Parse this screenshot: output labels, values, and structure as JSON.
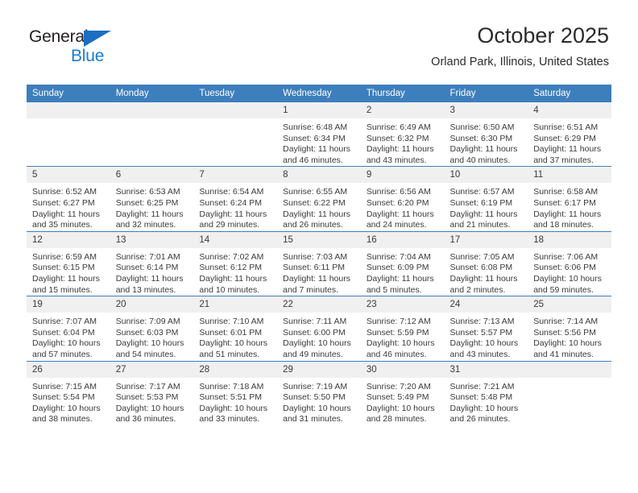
{
  "logo": {
    "word_top": "General",
    "word_bottom": "Blue",
    "triangle_icon": "triangle-icon",
    "color_dark": "#231f20",
    "color_blue": "#1b7ad4"
  },
  "header": {
    "title": "October 2025",
    "subtitle": "Orland Park, Illinois, United States"
  },
  "theme": {
    "header_bg": "#3d7ebd",
    "daynum_bg": "#f0f0f0",
    "text": "#3a3a3a"
  },
  "weekday_headers": [
    "Sunday",
    "Monday",
    "Tuesday",
    "Wednesday",
    "Thursday",
    "Friday",
    "Saturday"
  ],
  "labels": {
    "sunrise": "Sunrise:",
    "sunset": "Sunset:",
    "daylight": "Daylight:"
  },
  "weeks": [
    [
      {
        "day": "",
        "empty": true
      },
      {
        "day": "",
        "empty": true
      },
      {
        "day": "",
        "empty": true
      },
      {
        "day": "1",
        "sunrise": "Sunrise: 6:48 AM",
        "sunset": "Sunset: 6:34 PM",
        "daylight": "Daylight: 11 hours and 46 minutes."
      },
      {
        "day": "2",
        "sunrise": "Sunrise: 6:49 AM",
        "sunset": "Sunset: 6:32 PM",
        "daylight": "Daylight: 11 hours and 43 minutes."
      },
      {
        "day": "3",
        "sunrise": "Sunrise: 6:50 AM",
        "sunset": "Sunset: 6:30 PM",
        "daylight": "Daylight: 11 hours and 40 minutes."
      },
      {
        "day": "4",
        "sunrise": "Sunrise: 6:51 AM",
        "sunset": "Sunset: 6:29 PM",
        "daylight": "Daylight: 11 hours and 37 minutes."
      }
    ],
    [
      {
        "day": "5",
        "sunrise": "Sunrise: 6:52 AM",
        "sunset": "Sunset: 6:27 PM",
        "daylight": "Daylight: 11 hours and 35 minutes."
      },
      {
        "day": "6",
        "sunrise": "Sunrise: 6:53 AM",
        "sunset": "Sunset: 6:25 PM",
        "daylight": "Daylight: 11 hours and 32 minutes."
      },
      {
        "day": "7",
        "sunrise": "Sunrise: 6:54 AM",
        "sunset": "Sunset: 6:24 PM",
        "daylight": "Daylight: 11 hours and 29 minutes."
      },
      {
        "day": "8",
        "sunrise": "Sunrise: 6:55 AM",
        "sunset": "Sunset: 6:22 PM",
        "daylight": "Daylight: 11 hours and 26 minutes."
      },
      {
        "day": "9",
        "sunrise": "Sunrise: 6:56 AM",
        "sunset": "Sunset: 6:20 PM",
        "daylight": "Daylight: 11 hours and 24 minutes."
      },
      {
        "day": "10",
        "sunrise": "Sunrise: 6:57 AM",
        "sunset": "Sunset: 6:19 PM",
        "daylight": "Daylight: 11 hours and 21 minutes."
      },
      {
        "day": "11",
        "sunrise": "Sunrise: 6:58 AM",
        "sunset": "Sunset: 6:17 PM",
        "daylight": "Daylight: 11 hours and 18 minutes."
      }
    ],
    [
      {
        "day": "12",
        "sunrise": "Sunrise: 6:59 AM",
        "sunset": "Sunset: 6:15 PM",
        "daylight": "Daylight: 11 hours and 15 minutes."
      },
      {
        "day": "13",
        "sunrise": "Sunrise: 7:01 AM",
        "sunset": "Sunset: 6:14 PM",
        "daylight": "Daylight: 11 hours and 13 minutes."
      },
      {
        "day": "14",
        "sunrise": "Sunrise: 7:02 AM",
        "sunset": "Sunset: 6:12 PM",
        "daylight": "Daylight: 11 hours and 10 minutes."
      },
      {
        "day": "15",
        "sunrise": "Sunrise: 7:03 AM",
        "sunset": "Sunset: 6:11 PM",
        "daylight": "Daylight: 11 hours and 7 minutes."
      },
      {
        "day": "16",
        "sunrise": "Sunrise: 7:04 AM",
        "sunset": "Sunset: 6:09 PM",
        "daylight": "Daylight: 11 hours and 5 minutes."
      },
      {
        "day": "17",
        "sunrise": "Sunrise: 7:05 AM",
        "sunset": "Sunset: 6:08 PM",
        "daylight": "Daylight: 11 hours and 2 minutes."
      },
      {
        "day": "18",
        "sunrise": "Sunrise: 7:06 AM",
        "sunset": "Sunset: 6:06 PM",
        "daylight": "Daylight: 10 hours and 59 minutes."
      }
    ],
    [
      {
        "day": "19",
        "sunrise": "Sunrise: 7:07 AM",
        "sunset": "Sunset: 6:04 PM",
        "daylight": "Daylight: 10 hours and 57 minutes."
      },
      {
        "day": "20",
        "sunrise": "Sunrise: 7:09 AM",
        "sunset": "Sunset: 6:03 PM",
        "daylight": "Daylight: 10 hours and 54 minutes."
      },
      {
        "day": "21",
        "sunrise": "Sunrise: 7:10 AM",
        "sunset": "Sunset: 6:01 PM",
        "daylight": "Daylight: 10 hours and 51 minutes."
      },
      {
        "day": "22",
        "sunrise": "Sunrise: 7:11 AM",
        "sunset": "Sunset: 6:00 PM",
        "daylight": "Daylight: 10 hours and 49 minutes."
      },
      {
        "day": "23",
        "sunrise": "Sunrise: 7:12 AM",
        "sunset": "Sunset: 5:59 PM",
        "daylight": "Daylight: 10 hours and 46 minutes."
      },
      {
        "day": "24",
        "sunrise": "Sunrise: 7:13 AM",
        "sunset": "Sunset: 5:57 PM",
        "daylight": "Daylight: 10 hours and 43 minutes."
      },
      {
        "day": "25",
        "sunrise": "Sunrise: 7:14 AM",
        "sunset": "Sunset: 5:56 PM",
        "daylight": "Daylight: 10 hours and 41 minutes."
      }
    ],
    [
      {
        "day": "26",
        "sunrise": "Sunrise: 7:15 AM",
        "sunset": "Sunset: 5:54 PM",
        "daylight": "Daylight: 10 hours and 38 minutes."
      },
      {
        "day": "27",
        "sunrise": "Sunrise: 7:17 AM",
        "sunset": "Sunset: 5:53 PM",
        "daylight": "Daylight: 10 hours and 36 minutes."
      },
      {
        "day": "28",
        "sunrise": "Sunrise: 7:18 AM",
        "sunset": "Sunset: 5:51 PM",
        "daylight": "Daylight: 10 hours and 33 minutes."
      },
      {
        "day": "29",
        "sunrise": "Sunrise: 7:19 AM",
        "sunset": "Sunset: 5:50 PM",
        "daylight": "Daylight: 10 hours and 31 minutes."
      },
      {
        "day": "30",
        "sunrise": "Sunrise: 7:20 AM",
        "sunset": "Sunset: 5:49 PM",
        "daylight": "Daylight: 10 hours and 28 minutes."
      },
      {
        "day": "31",
        "sunrise": "Sunrise: 7:21 AM",
        "sunset": "Sunset: 5:48 PM",
        "daylight": "Daylight: 10 hours and 26 minutes."
      },
      {
        "day": "",
        "empty": true
      }
    ]
  ]
}
